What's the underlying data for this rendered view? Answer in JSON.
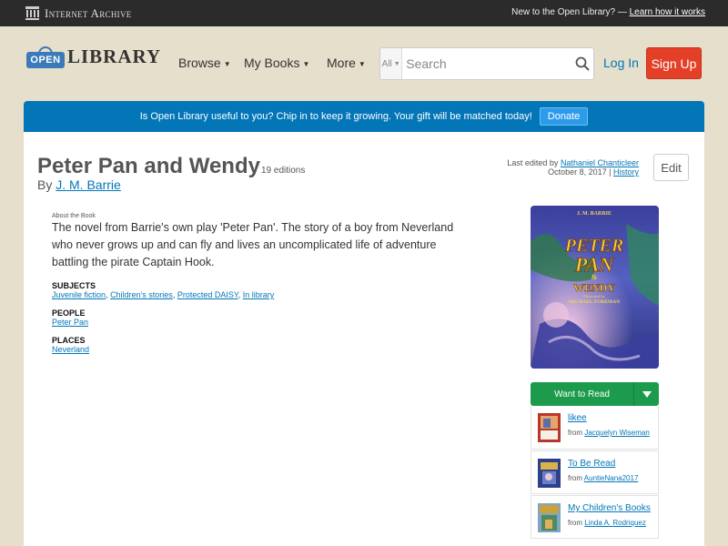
{
  "ia_bar": {
    "brand": "Internet Archive",
    "prompt": "New to the Open Library? —",
    "learn_link": "Learn how it works"
  },
  "header": {
    "logo_open": "OPEN",
    "logo_library": "LIBRARY",
    "nav": [
      {
        "label": "Browse"
      },
      {
        "label": "My Books"
      },
      {
        "label": "More"
      }
    ],
    "search": {
      "scope": "All",
      "placeholder": "Search"
    },
    "login": "Log In",
    "signup": "Sign Up"
  },
  "banner": {
    "text": "Is Open Library useful to you? Chip in to keep it growing. Your gift will be matched today!",
    "button": "Donate"
  },
  "book": {
    "title": "Peter Pan and Wendy",
    "editions": "19 editions",
    "by": "By",
    "author": "J. M. Barrie",
    "about_label": "About the Book",
    "description": "The novel from Barrie's own play 'Peter Pan'. The story of a boy from Neverland who never grows up and can fly and lives an uncomplicated life of adventure battling the pirate Captain Hook.",
    "subjects_head": "SUBJECTS",
    "subjects": [
      "Juvenile fiction",
      "Children's stories",
      "Protected DAISY",
      "In library"
    ],
    "people_head": "PEOPLE",
    "people": [
      "Peter Pan"
    ],
    "places_head": "PLACES",
    "places": [
      "Neverland"
    ],
    "cover": {
      "author": "J. M. BARRIE",
      "title_line1": "PETER",
      "title_line2": "PAN",
      "title_amp": "&",
      "title_line3": "WENDY",
      "illustrated": "Illustrated by",
      "illustrator": "MICHAEL FOREMAN"
    }
  },
  "edit_info": {
    "last_edited_by": "Last edited by",
    "editor": "Nathaniel Chanticleer",
    "date": "October 8, 2017",
    "separator": "|",
    "history": "History",
    "edit_button": "Edit"
  },
  "reading": {
    "want_to_read": "Want to Read"
  },
  "lists": [
    {
      "title": "likee",
      "from": "from",
      "user": "Jacquelyn Wiseman",
      "thumb_color": "#d7502b"
    },
    {
      "title": "To Be Read",
      "from": "from",
      "user": "AuntieNana2017",
      "thumb_color": "#3b56a8"
    },
    {
      "title": "My Children's Books",
      "from": "from",
      "user": "Linda A. Rodriquez",
      "thumb_color": "#7fa6c9"
    }
  ],
  "colors": {
    "page_bg": "#e6dfcb",
    "ia_bar": "#2b2b2b",
    "banner": "#0376b8",
    "signup": "#e44028",
    "want_to_read": "#1d9b4d",
    "link": "#0376b8"
  }
}
